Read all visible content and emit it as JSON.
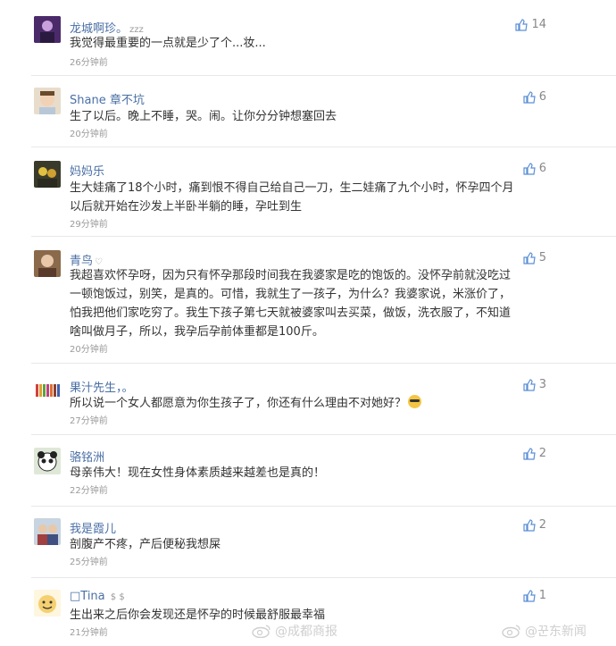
{
  "comments": [
    {
      "name": "龙城啊珍。",
      "name_tag": "zzz",
      "text": "我觉得最重要的一点就是少了个...妆...",
      "time": "26分钟前",
      "likes": "14"
    },
    {
      "name": "Shane 章不坑",
      "text": "生了以后。晚上不睡，哭。闹。让你分分钟想塞回去",
      "time": "20分钟前",
      "likes": "6"
    },
    {
      "name": "妈妈乐",
      "text": "生大娃痛了18个小时，痛到恨不得自己给自己一刀，生二娃痛了九个小时，怀孕四个月\n以后就开始在沙发上半卧半躺的睡，孕吐到生",
      "time": "29分钟前",
      "likes": "6"
    },
    {
      "name": "青鸟",
      "name_tag": "♡",
      "text": "我超喜欢怀孕呀，因为只有怀孕那段时间我在我婆家是吃的饱饭的。没怀孕前就没吃过\n一顿饱饭过，别笑，是真的。可惜，我就生了一孩子，为什么？我婆家说，米涨价了，\n怕我把他们家吃穷了。我生下孩子第七天就被婆家叫去买菜，做饭，洗衣服了，不知道\n啥叫做月子，所以，我孕后孕前体重都是100斤。",
      "time": "20分钟前",
      "likes": "5"
    },
    {
      "name": "果汁先生，。",
      "text": "所以说一个女人都愿意为你生孩子了，你还有什么理由不对她好？",
      "time": "27分钟前",
      "likes": "3"
    },
    {
      "name": "骆铭洲",
      "text": "母亲伟大！现在女性身体素质越来越差也是真的！",
      "time": "22分钟前",
      "likes": "2"
    },
    {
      "name": "我是霞儿",
      "text": "剖腹产不疼，产后便秘我想屎",
      "time": "25分钟前",
      "likes": "2"
    },
    {
      "name": "□Tina",
      "name_tag": "$ $",
      "text": "生出来之后你会发现还是怀孕的时候最舒服最幸福",
      "time": "21分钟前",
      "likes": "1"
    }
  ],
  "watermarks": {
    "left": "@成都商报",
    "right": "@꾼东新闻"
  },
  "colors": {
    "name": "#4a6fa5",
    "text": "#333333",
    "time": "#9a9a9a",
    "like_icon": "#5b8fd6"
  }
}
